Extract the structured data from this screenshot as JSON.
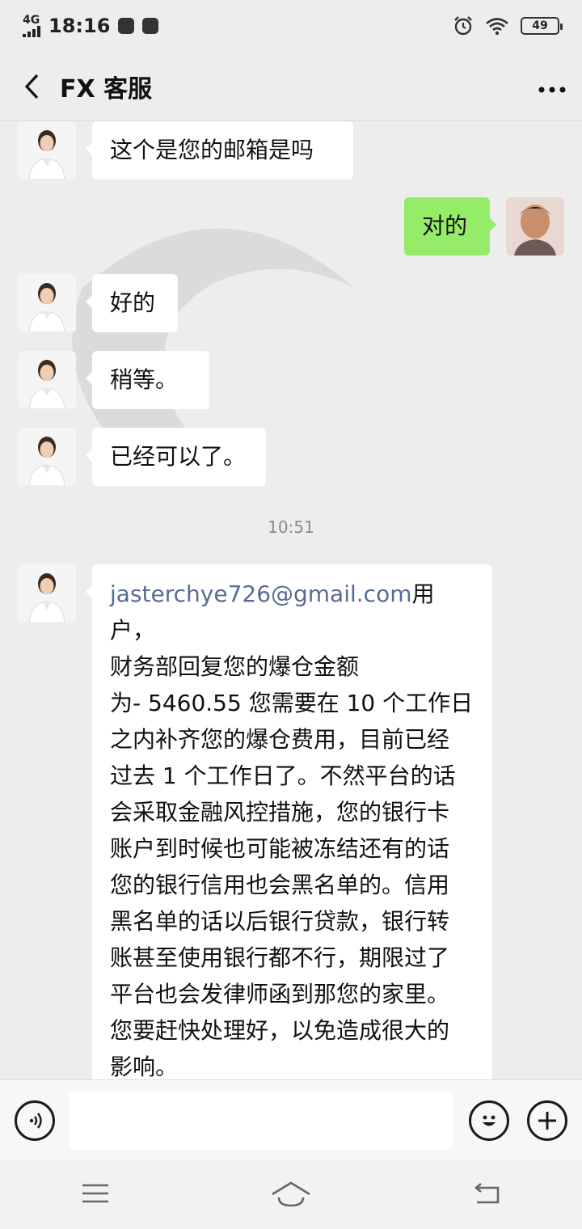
{
  "status_bar": {
    "network": "4G",
    "time": "18:16",
    "battery": "49"
  },
  "header": {
    "title": "FX 客服"
  },
  "messages": [
    {
      "side": "in",
      "text": "这个是您的邮箱是吗"
    },
    {
      "side": "out",
      "text": "对的"
    },
    {
      "side": "in",
      "text": "好的"
    },
    {
      "side": "in",
      "text": "稍等。"
    },
    {
      "side": "in",
      "text": "已经可以了。"
    }
  ],
  "timestamp": "10:51",
  "long_message": {
    "email": "jasterchye726@gmail.com",
    "lines": [
      "用户，",
      "财务部回复您的爆仓金额",
      "为- 5460.55 您需要在 10 个工作日",
      "之内补齐您的爆仓费用，目前已经",
      "过去 1 个工作日了。不然平台的话",
      "会采取金融风控措施，您的银行卡",
      "账户到时候也可能被冻结还有的话",
      "您的银行信用也会黑名单的。信用",
      "黑名单的话以后银行贷款，银行转",
      "账甚至使用银行都不行，期限过了",
      "平台也会发律师函到那您的家里。",
      "您要赶快处理好，以免造成很大的",
      "影响。"
    ]
  },
  "colors": {
    "outgoing_bubble": "#95ec69",
    "incoming_bubble": "#ffffff",
    "background": "#ededed",
    "link": "#576b95"
  },
  "icons": {
    "back": "chevron-left-icon",
    "more": "more-dots-icon",
    "voice": "voice-icon",
    "emoji": "emoji-icon",
    "add": "plus-icon",
    "nav_menu": "menu-icon",
    "nav_home": "home-icon",
    "nav_back": "return-icon"
  }
}
